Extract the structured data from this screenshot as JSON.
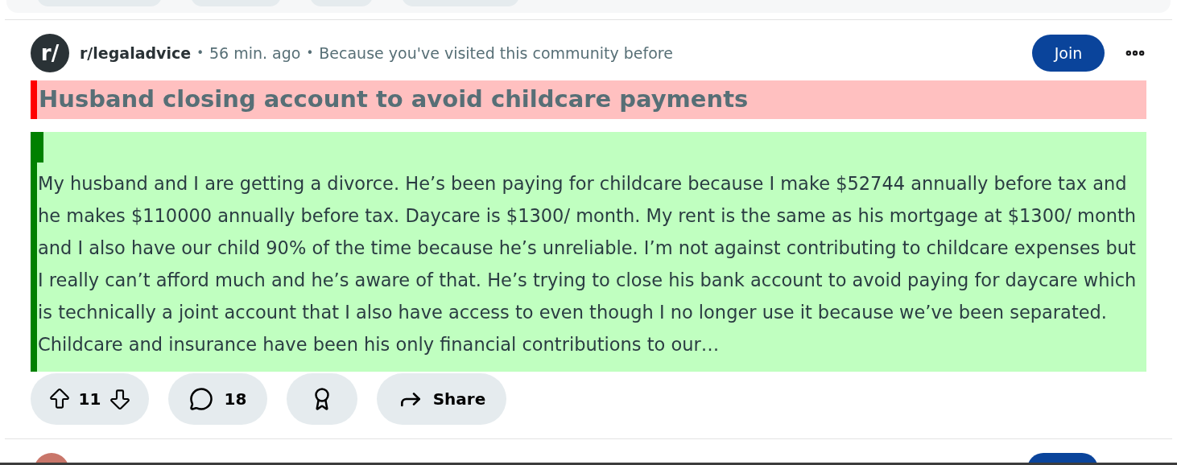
{
  "top_chips": [
    {
      "kind": "chip"
    },
    {
      "kind": "chip"
    },
    {
      "kind": "chip"
    },
    {
      "kind": "chip"
    }
  ],
  "post": {
    "avatar_text": "r/",
    "subreddit": "r/legaladvice",
    "separators": [
      "•",
      "•"
    ],
    "time": "56 min. ago",
    "reason": "Because you've visited this community before",
    "join": "Join",
    "title": "Husband closing account to avoid childcare payments",
    "body": "My husband and I are getting a divorce. He’s been paying for childcare because I make $52744 annually before tax and he makes $110000 annually before tax. Daycare is $1300/ month. My rent is the same as his mortgage at $1300/ month and I also have our child 90% of the time because he’s unreliable. I’m not against contributing to childcare expenses but I really can’t afford much and he’s aware of that. He’s trying to close his bank account to avoid paying for daycare which is technically a joint account that I also have access to even though I no longer use it because we’ve been separated. Childcare and insurance have been his only financial contributions to our…",
    "votes": "11",
    "comments": "18",
    "share": "Share"
  },
  "next_post": {
    "kind": "partial"
  }
}
